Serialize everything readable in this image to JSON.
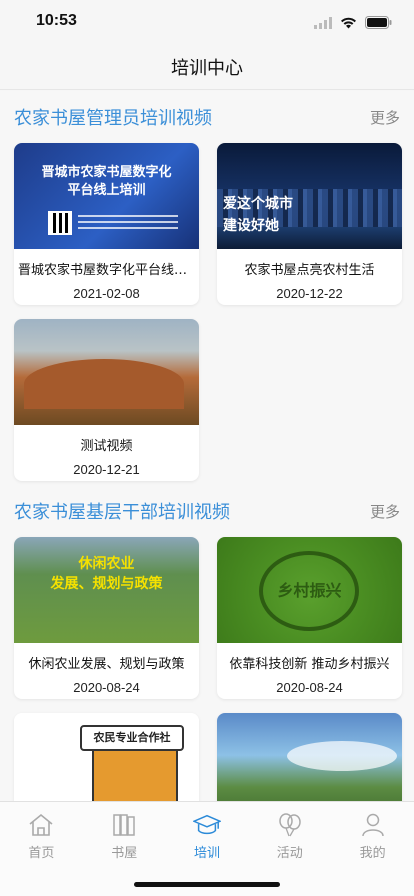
{
  "status_bar": {
    "time": "10:53"
  },
  "nav": {
    "title": "培训中心"
  },
  "sections": [
    {
      "title": "农家书屋管理员培训视频",
      "more": "更多",
      "videos": [
        {
          "title": "晋城农家书屋数字化平台线上培训",
          "date": "2021-02-08",
          "thumb_text": [
            "晋城市农家书屋数字化",
            "平台线上培训"
          ]
        },
        {
          "title": "农家书屋点亮农村生活",
          "date": "2020-12-22",
          "thumb_text": [
            "爱这个城市",
            "建设好她"
          ]
        },
        {
          "title": "测试视频",
          "date": "2020-12-21"
        }
      ]
    },
    {
      "title": "农家书屋基层干部培训视频",
      "more": "更多",
      "videos": [
        {
          "title": "休闲农业发展、规划与政策",
          "date": "2020-08-24",
          "thumb_text": [
            "休闲农业",
            "发展、规划与政策"
          ]
        },
        {
          "title": "依靠科技创新 推动乡村振兴",
          "date": "2020-08-24",
          "thumb_text": [
            "乡村振兴"
          ]
        },
        {
          "title": "",
          "date": "",
          "thumb_text": [
            "农民专业合作社"
          ]
        },
        {
          "title": "",
          "date": ""
        }
      ]
    }
  ],
  "tab_bar": {
    "active": "培训",
    "tabs": [
      {
        "label": "首页",
        "icon": "home-icon"
      },
      {
        "label": "书屋",
        "icon": "books-icon"
      },
      {
        "label": "培训",
        "icon": "graduation-cap-icon"
      },
      {
        "label": "活动",
        "icon": "balloons-icon"
      },
      {
        "label": "我的",
        "icon": "person-icon"
      }
    ]
  },
  "colors": {
    "accent": "#2b8ad8",
    "section_title": "#3b8fd8",
    "inactive": "#999999"
  }
}
